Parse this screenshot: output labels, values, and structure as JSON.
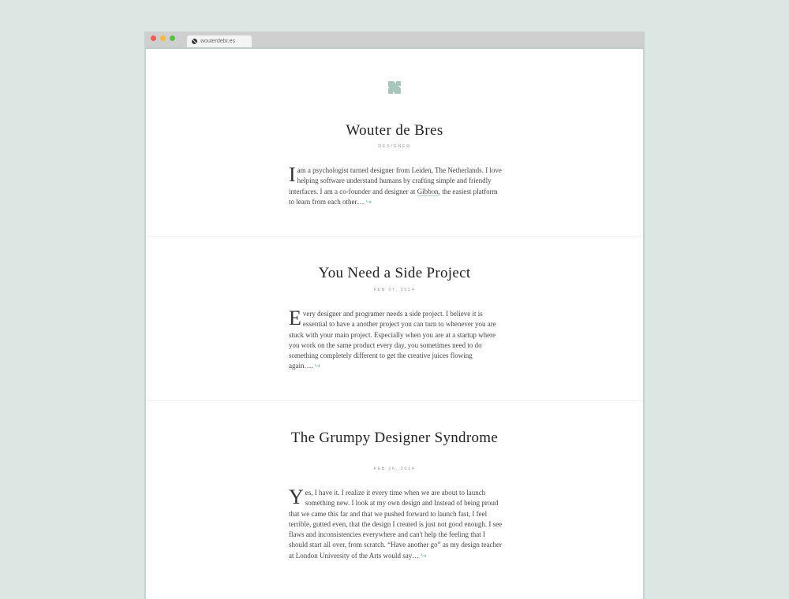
{
  "browser": {
    "tab_title": "wouterdebr.es"
  },
  "intro": {
    "name": "Wouter de Bres",
    "role": "DESIGNER",
    "dropcap": "I",
    "text_before_link": " am a psychologist turned designer from Leiden, The Netherlands. I love helping software understand humans by crafting simple and friendly interfaces. I am a co-founder and designer at ",
    "link_text": "Gibbon",
    "text_after_link": ", the easiest platform to learn from each other…",
    "more_arrow": "↪"
  },
  "posts": [
    {
      "title": "You Need a Side Project",
      "date": "FEB 27, 2014",
      "dropcap": "E",
      "text": "very designer and programer needs a side project. I believe it is essential to have a another project you can turn to whenever you are stuck with your main project. Especially when you are at a startup where you work on the same product every day, you sometimes need to do something completely different to get the creative juices flowing again….",
      "more_arrow": "↪"
    },
    {
      "title": "The Grumpy Designer Syndrome",
      "date": "FEB 26, 2014",
      "dropcap": "Y",
      "text": "es, I have it. I realize it every time when we are about to launch something new. I look at my own design and Instead of being proud that we came this far and that we pushed forward to launch fast, I feel terrible, gutted even, that the design I created is just not good enough. I see flaws and inconsistencies everywhere and can't help the feeling that I should start all over, from scratch. “Have another go” as my design teacher at London University of the Arts would say…",
      "more_arrow": "↪"
    }
  ],
  "colors": {
    "background": "#dce6e3",
    "accent": "#8bb5a7"
  }
}
